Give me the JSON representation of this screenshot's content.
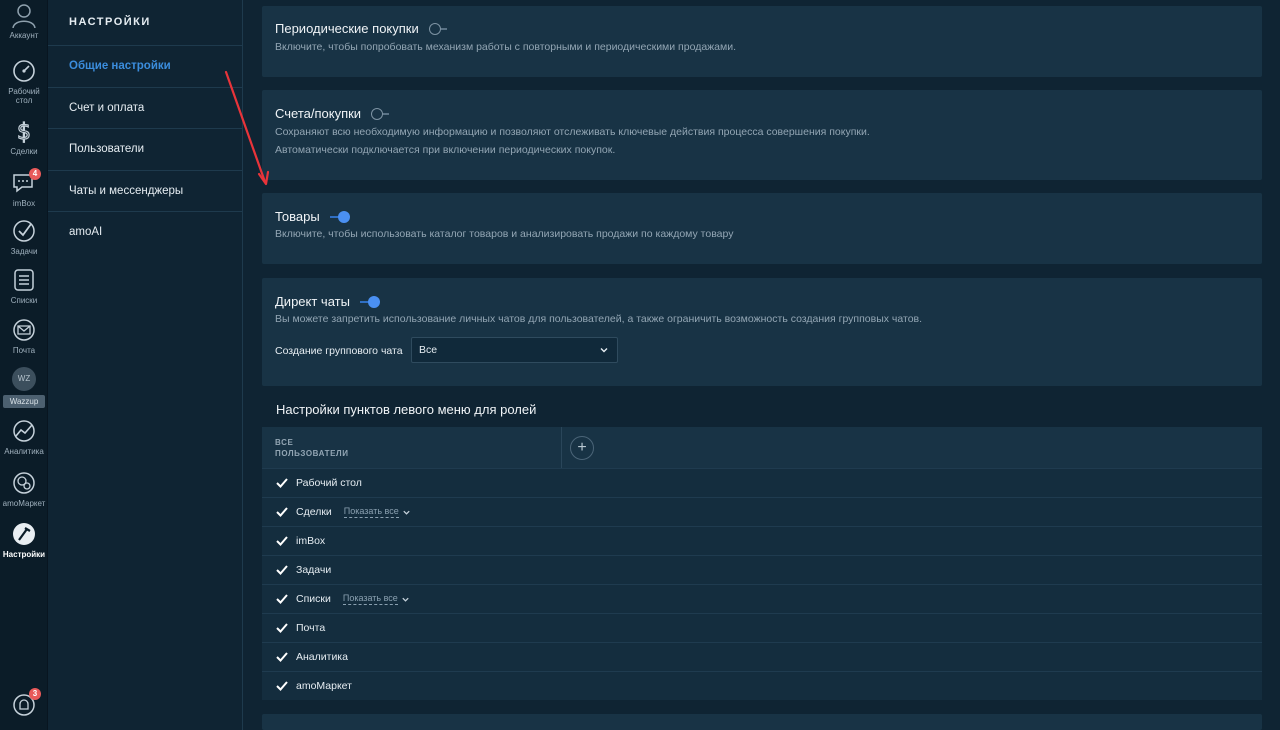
{
  "rail": {
    "account": "Аккаунт",
    "items": [
      {
        "label": "Рабочий стол",
        "icon": "dashboard-icon"
      },
      {
        "label": "Сделки",
        "icon": "dollar-icon"
      },
      {
        "label": "imBox",
        "icon": "chat-icon",
        "badge": "4"
      },
      {
        "label": "Задачи",
        "icon": "task-check-icon"
      },
      {
        "label": "Списки",
        "icon": "list-icon"
      },
      {
        "label": "Почта",
        "icon": "mail-icon"
      },
      {
        "label": "Wazzup",
        "icon": "wazzup-icon",
        "short": "WZ"
      },
      {
        "label": "Аналитика",
        "icon": "analytics-icon"
      },
      {
        "label": "amoМаркет",
        "icon": "market-icon"
      },
      {
        "label": "Настройки",
        "icon": "settings-icon"
      }
    ],
    "notifications_badge": "3"
  },
  "settings_nav": {
    "title": "НАСТРОЙКИ",
    "items": [
      {
        "label": "Общие настройки",
        "active": true
      },
      {
        "label": "Счет и оплата"
      },
      {
        "label": "Пользователи"
      },
      {
        "label": "Чаты и мессенджеры"
      },
      {
        "label": "amoAI"
      }
    ]
  },
  "cards": {
    "periodic": {
      "title": "Периодические покупки",
      "enabled": false,
      "desc": "Включите, чтобы попробовать механизм работы с повторными и периодическими продажами."
    },
    "invoices": {
      "title": "Счета/покупки",
      "enabled": false,
      "desc1": "Сохраняют всю необходимую информацию и позволяют отслеживать ключевые действия процесса совершения покупки.",
      "desc2": "Автоматически подключается при включении периодических покупок."
    },
    "products": {
      "title": "Товары",
      "enabled": true,
      "desc": "Включите, чтобы использовать каталог товаров и анализировать продажи по каждому товару"
    },
    "direct_chats": {
      "title": "Директ чаты",
      "enabled": true,
      "desc": "Вы можете запретить использование личных чатов для пользователей, а также ограничить возможность создания групповых чатов.",
      "group_label": "Создание группового чата",
      "group_value": "Все"
    }
  },
  "menu_roles": {
    "title": "Настройки пунктов левого меню для ролей",
    "column_line1": "ВСЕ",
    "column_line2": "ПОЛЬЗОВАТЕЛИ",
    "add_label": "+",
    "show_all_label": "Показать все",
    "rows": [
      {
        "label": "Рабочий стол",
        "checked": true
      },
      {
        "label": "Сделки",
        "checked": true,
        "show_all": true
      },
      {
        "label": "imBox",
        "checked": true
      },
      {
        "label": "Задачи",
        "checked": true
      },
      {
        "label": "Списки",
        "checked": true,
        "show_all": true
      },
      {
        "label": "Почта",
        "checked": true
      },
      {
        "label": "Аналитика",
        "checked": true
      },
      {
        "label": "amoМаркет",
        "checked": true
      }
    ]
  },
  "colors": {
    "accent": "#3b8ddd",
    "toggle_on": "#4a90f2",
    "annotation_arrow": "#e8343a"
  }
}
